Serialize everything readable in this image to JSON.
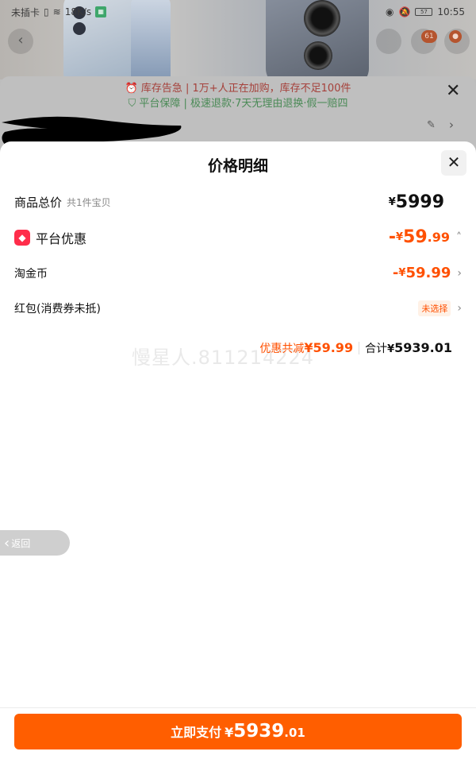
{
  "status_bar": {
    "carrier": "未插卡",
    "speed": "18K/s",
    "time": "10:55",
    "battery": "57"
  },
  "background": {
    "cart_badge": "61",
    "alert_stock": "库存告急 | 1万+人正在加购，库存不足100件",
    "alert_guarantee": "平台保障 | 极速退款·7天无理由退换·假一赔四"
  },
  "sheet": {
    "title": "价格明细",
    "items_total": {
      "label": "商品总价",
      "sub": "共1件宝贝",
      "currency": "¥",
      "value": "5999"
    },
    "platform_discount": {
      "label": "平台优惠",
      "prefix": "-",
      "currency": "¥",
      "int": "59",
      "dec": ".99"
    },
    "taojinbi": {
      "label": "淘金币",
      "prefix": "-",
      "currency": "¥",
      "int": "59",
      "dec": ".99"
    },
    "red_packet": {
      "label": "红包(消费券未抵)",
      "status": "未选择"
    },
    "summary": {
      "saved_label": "优惠共减",
      "saved_value": "¥59.99",
      "total_label": "合计",
      "total_currency": "¥",
      "total_int": "5939",
      "total_dec": ".01"
    },
    "watermark": "慢星人.811214224"
  },
  "back_button": {
    "label": "返回"
  },
  "pay_button": {
    "label": "立即支付",
    "currency": "¥",
    "int": "5939",
    "dec": ".01"
  },
  "colors": {
    "accent": "#ff5000",
    "pay_button": "#ff5e00",
    "discount_tag": "#ff2d4a"
  }
}
